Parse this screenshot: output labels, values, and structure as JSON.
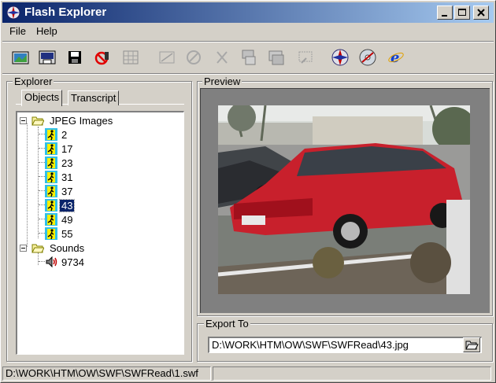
{
  "window": {
    "title": "Flash Explorer"
  },
  "menu": {
    "items": [
      "File",
      "Help"
    ]
  },
  "toolbar": {
    "buttons": [
      "open-icon",
      "save-as-icon",
      "save-icon",
      "no-entry-icon",
      "grid-disabled-icon",
      "resize-disabled-icon",
      "circle-disabled-icon",
      "cut-disabled-icon",
      "export-disabled-icon",
      "film-disabled-icon",
      "zoom-disabled-icon",
      "globe-icon",
      "flash-cd-icon",
      "ie-icon"
    ]
  },
  "explorer": {
    "title": "Explorer",
    "tabs": [
      "Objects",
      "Transcript"
    ],
    "tree": {
      "jpeg_group": "JPEG Images",
      "jpeg_items": [
        "2",
        "17",
        "23",
        "31",
        "37",
        "43",
        "49",
        "55"
      ],
      "selected": "43",
      "sounds_group": "Sounds",
      "sound_items": [
        "9734"
      ]
    }
  },
  "preview": {
    "title": "Preview"
  },
  "export": {
    "title": "Export To",
    "path": "D:\\WORK\\HTM\\OW\\SWF\\SWFRead\\43.jpg"
  },
  "status": {
    "text": "D:\\WORK\\HTM\\OW\\SWF\\SWFRead\\1.swf"
  },
  "colors": {
    "titlebar_start": "#0a246a",
    "titlebar_end": "#a6caf0",
    "face": "#d4d0c8",
    "selection": "#0a246a"
  }
}
